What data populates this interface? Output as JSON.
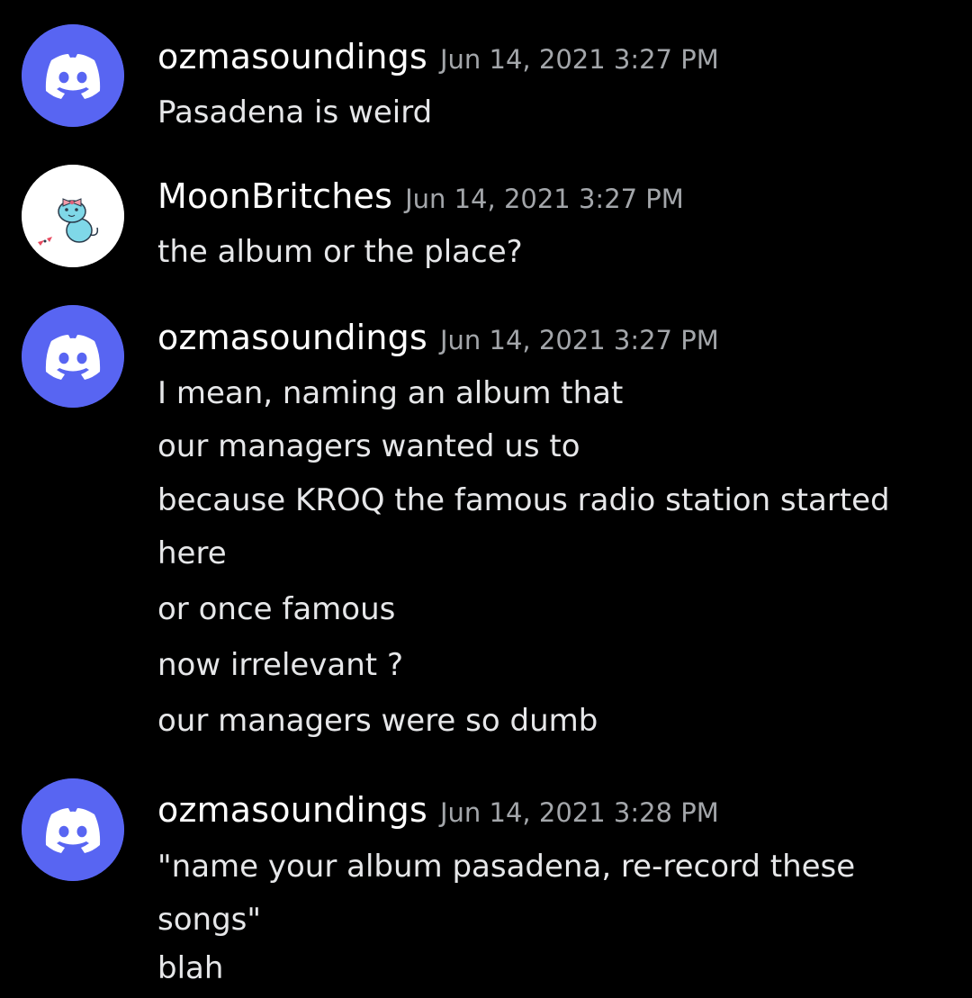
{
  "colors": {
    "background": "#000000",
    "discord_blurple": "#5865f2",
    "username": "#ffffff",
    "timestamp": "#a3a6aa",
    "message_text": "#e6e7e9"
  },
  "messages": [
    {
      "avatar_icon": "discord-logo-icon",
      "username": "ozmasoundings",
      "timestamp": "Jun 14, 2021 3:27 PM",
      "lines": [
        "Pasadena is weird"
      ]
    },
    {
      "avatar_icon": "cartoon-character-avatar",
      "username": "MoonBritches",
      "timestamp": "Jun 14, 2021 3:27 PM",
      "lines": [
        "the album or the place?"
      ]
    },
    {
      "avatar_icon": "discord-logo-icon",
      "username": "ozmasoundings",
      "timestamp": "Jun 14, 2021 3:27 PM",
      "lines": [
        "I mean, naming an album that",
        "our managers wanted us to",
        "because KROQ the famous radio station started",
        "here",
        "or once famous",
        "now irrelevant ?",
        "our managers were so dumb"
      ]
    },
    {
      "avatar_icon": "discord-logo-icon",
      "username": "ozmasoundings",
      "timestamp": "Jun 14, 2021 3:28 PM",
      "lines": [
        "\"name your album pasadena, re-record these",
        "songs\"",
        "blah"
      ]
    }
  ]
}
